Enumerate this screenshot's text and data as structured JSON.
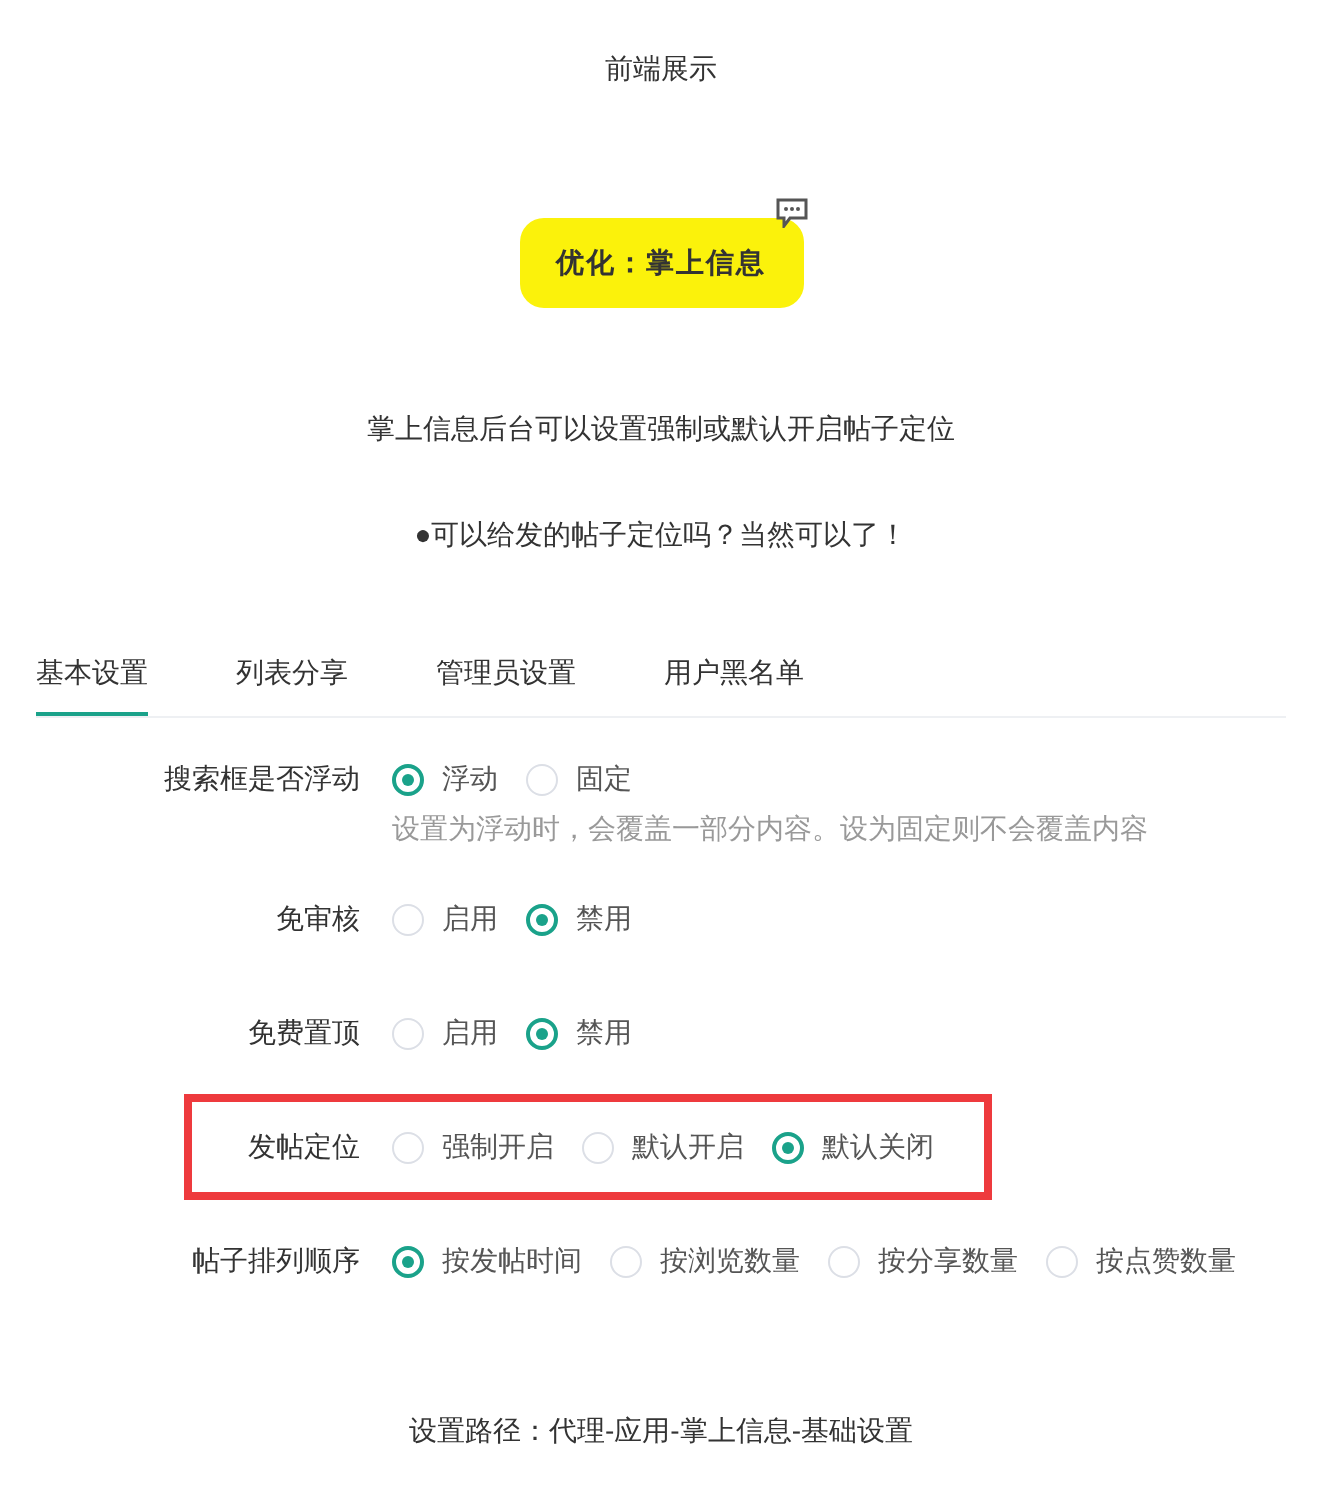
{
  "page_title": "前端展示",
  "badge": {
    "label": "优化：掌上信息"
  },
  "intro": "掌上信息后台可以设置强制或默认开启帖子定位",
  "question": "●可以给发的帖子定位吗？当然可以了！",
  "tabs": [
    {
      "label": "基本设置",
      "selected": true
    },
    {
      "label": "列表分享",
      "selected": false
    },
    {
      "label": "管理员设置",
      "selected": false
    },
    {
      "label": "用户黑名单",
      "selected": false
    }
  ],
  "settings": [
    {
      "label": "搜索框是否浮动",
      "highlighted": false,
      "options": [
        {
          "label": "浮动",
          "selected": true
        },
        {
          "label": "固定",
          "selected": false
        }
      ],
      "hint": "设置为浮动时，会覆盖一部分内容。设为固定则不会覆盖内容"
    },
    {
      "label": "免审核",
      "highlighted": false,
      "options": [
        {
          "label": "启用",
          "selected": false
        },
        {
          "label": "禁用",
          "selected": true
        }
      ]
    },
    {
      "label": "免费置顶",
      "highlighted": false,
      "options": [
        {
          "label": "启用",
          "selected": false
        },
        {
          "label": "禁用",
          "selected": true
        }
      ]
    },
    {
      "label": "发帖定位",
      "highlighted": true,
      "options": [
        {
          "label": "强制开启",
          "selected": false
        },
        {
          "label": "默认开启",
          "selected": false
        },
        {
          "label": "默认关闭",
          "selected": true
        }
      ]
    },
    {
      "label": "帖子排列顺序",
      "highlighted": false,
      "options": [
        {
          "label": "按发帖时间",
          "selected": true
        },
        {
          "label": "按浏览数量",
          "selected": false
        },
        {
          "label": "按分享数量",
          "selected": false
        },
        {
          "label": "按点赞数量",
          "selected": false
        }
      ]
    }
  ],
  "footer": "设置路径：代理-应用-掌上信息-基础设置"
}
